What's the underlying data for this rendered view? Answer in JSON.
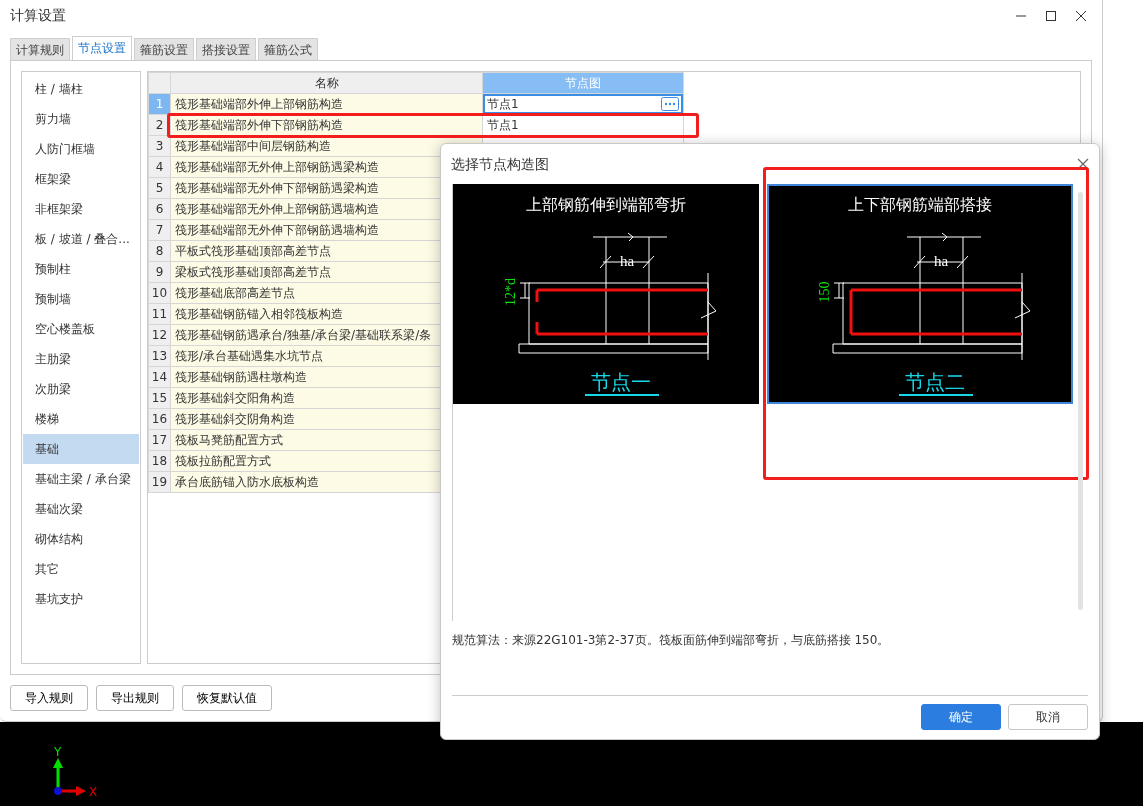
{
  "window": {
    "title": "计算设置"
  },
  "tabs": [
    {
      "label": "计算规则",
      "selected": false
    },
    {
      "label": "节点设置",
      "selected": true
    },
    {
      "label": "箍筋设置",
      "selected": false
    },
    {
      "label": "搭接设置",
      "selected": false
    },
    {
      "label": "箍筋公式",
      "selected": false
    }
  ],
  "sidebar": {
    "items": [
      {
        "label": "柱 / 墙柱",
        "selected": false
      },
      {
        "label": "剪力墙",
        "selected": false
      },
      {
        "label": "人防门框墙",
        "selected": false
      },
      {
        "label": "框架梁",
        "selected": false
      },
      {
        "label": "非框架梁",
        "selected": false
      },
      {
        "label": "板 / 坡道 / 叠合...",
        "selected": false
      },
      {
        "label": "预制柱",
        "selected": false
      },
      {
        "label": "预制墙",
        "selected": false
      },
      {
        "label": "空心楼盖板",
        "selected": false
      },
      {
        "label": "主肋梁",
        "selected": false
      },
      {
        "label": "次肋梁",
        "selected": false
      },
      {
        "label": "楼梯",
        "selected": false
      },
      {
        "label": "基础",
        "selected": true
      },
      {
        "label": "基础主梁 / 承台梁",
        "selected": false
      },
      {
        "label": "基础次梁",
        "selected": false
      },
      {
        "label": "砌体结构",
        "selected": false
      },
      {
        "label": "其它",
        "selected": false
      },
      {
        "label": "基坑支护",
        "selected": false
      }
    ]
  },
  "table": {
    "columns": [
      {
        "label": "名称",
        "selected": false
      },
      {
        "label": "节点图",
        "selected": true
      }
    ],
    "rows": [
      {
        "number": "1",
        "name": "筏形基础端部外伸上部钢筋构造",
        "node": "节点1",
        "selected": true,
        "highlighted": false
      },
      {
        "number": "2",
        "name": "筏形基础端部外伸下部钢筋构造",
        "node": "节点1",
        "selected": false,
        "highlighted": true
      },
      {
        "number": "3",
        "name": "筏形基础端部中间层钢筋构造",
        "selected": false,
        "highlighted": false
      },
      {
        "number": "4",
        "name": "筏形基础端部无外伸上部钢筋遇梁构造",
        "selected": false,
        "highlighted": false
      },
      {
        "number": "5",
        "name": "筏形基础端部无外伸下部钢筋遇梁构造",
        "selected": false,
        "highlighted": false
      },
      {
        "number": "6",
        "name": "筏形基础端部无外伸上部钢筋遇墙构造",
        "selected": false,
        "highlighted": false
      },
      {
        "number": "7",
        "name": "筏形基础端部无外伸下部钢筋遇墙构造",
        "selected": false,
        "highlighted": false
      },
      {
        "number": "8",
        "name": "平板式筏形基础顶部高差节点",
        "selected": false,
        "highlighted": false
      },
      {
        "number": "9",
        "name": "梁板式筏形基础顶部高差节点",
        "selected": false,
        "highlighted": false
      },
      {
        "number": "10",
        "name": "筏形基础底部高差节点",
        "selected": false,
        "highlighted": false
      },
      {
        "number": "11",
        "name": "筏形基础钢筋锚入相邻筏板构造",
        "selected": false,
        "highlighted": false
      },
      {
        "number": "12",
        "name": "筏形基础钢筋遇承台/独基/承台梁/基础联系梁/条",
        "selected": false,
        "highlighted": false
      },
      {
        "number": "13",
        "name": "筏形/承台基础遇集水坑节点",
        "selected": false,
        "highlighted": false
      },
      {
        "number": "14",
        "name": "筏形基础钢筋遇柱墩构造",
        "selected": false,
        "highlighted": false
      },
      {
        "number": "15",
        "name": "筏形基础斜交阳角构造",
        "selected": false,
        "highlighted": false
      },
      {
        "number": "16",
        "name": "筏形基础斜交阴角构造",
        "selected": false,
        "highlighted": false
      },
      {
        "number": "17",
        "name": "筏板马凳筋配置方式",
        "selected": false,
        "highlighted": false
      },
      {
        "number": "18",
        "name": "筏板拉筋配置方式",
        "selected": false,
        "highlighted": false
      },
      {
        "number": "19",
        "name": "承台底筋锚入防水底板构造",
        "selected": false,
        "highlighted": false
      }
    ]
  },
  "buttons": [
    "导入规则",
    "导出规则",
    "恢复默认值"
  ],
  "dialog": {
    "title": "选择节点构造图",
    "options": [
      {
        "title": "上部钢筋伸到端部弯折",
        "width_label": "ha",
        "dimension": "12*d",
        "caption": "节点一",
        "kind": "bend",
        "selected": false,
        "highlighted": false
      },
      {
        "title": "上下部钢筋端部搭接",
        "width_label": "ha",
        "dimension": "150",
        "caption": "节点二",
        "kind": "lap",
        "selected": true,
        "highlighted": true
      }
    ],
    "description": "规范算法：来源22G101-3第2-37页。筏板面筋伸到端部弯折，与底筋搭接 150。",
    "buttons": [
      {
        "label": "确定",
        "kind": "primary"
      },
      {
        "label": "取消",
        "kind": "secondary"
      }
    ]
  },
  "axis": {
    "x": "X",
    "y": "Y"
  }
}
